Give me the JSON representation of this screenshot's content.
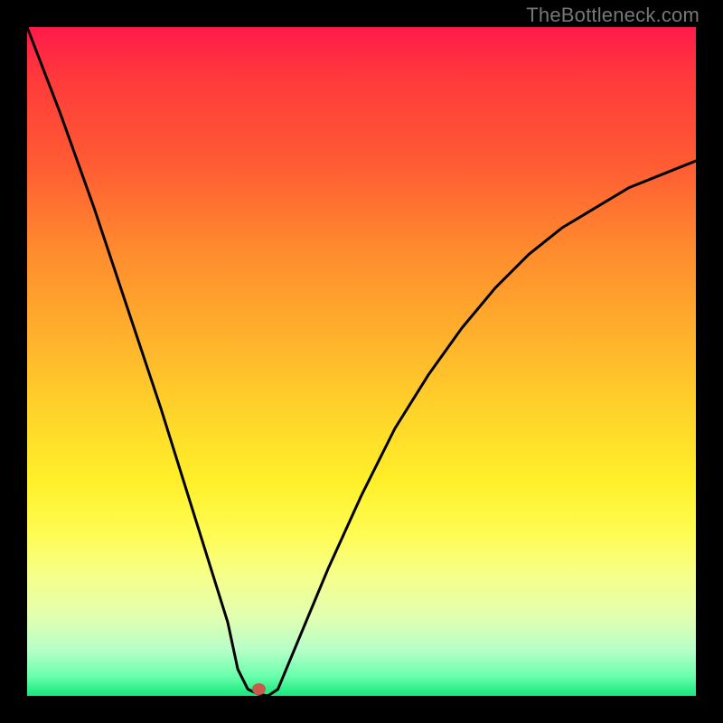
{
  "watermark": "TheBottleneck.com",
  "chart_data": {
    "type": "line",
    "title": "",
    "xlabel": "",
    "ylabel": "",
    "xlim": [
      0,
      100
    ],
    "ylim": [
      0,
      100
    ],
    "grid": false,
    "legend": false,
    "background_gradient": {
      "direction": "vertical",
      "stops": [
        {
          "pos": 0.0,
          "color": "#ff1a4a"
        },
        {
          "pos": 0.5,
          "color": "#ffb02c"
        },
        {
          "pos": 0.75,
          "color": "#fffc55"
        },
        {
          "pos": 1.0,
          "color": "#16e77a"
        }
      ]
    },
    "series": [
      {
        "name": "bottleneck-curve",
        "color": "#000000",
        "x": [
          0,
          5,
          10,
          15,
          20,
          25,
          30,
          31.5,
          33,
          34.5,
          36,
          37.5,
          40,
          45,
          50,
          55,
          60,
          65,
          70,
          75,
          80,
          85,
          90,
          95,
          100
        ],
        "y": [
          100,
          87,
          73,
          58,
          43,
          27,
          11,
          4,
          1,
          0.3,
          0,
          1,
          7,
          19,
          30,
          40,
          48,
          55,
          61,
          66,
          70,
          73,
          76,
          78,
          80
        ]
      }
    ],
    "annotations": [
      {
        "type": "point",
        "name": "minimum",
        "x": 36,
        "y": 0,
        "color": "#c85a4a"
      }
    ]
  }
}
